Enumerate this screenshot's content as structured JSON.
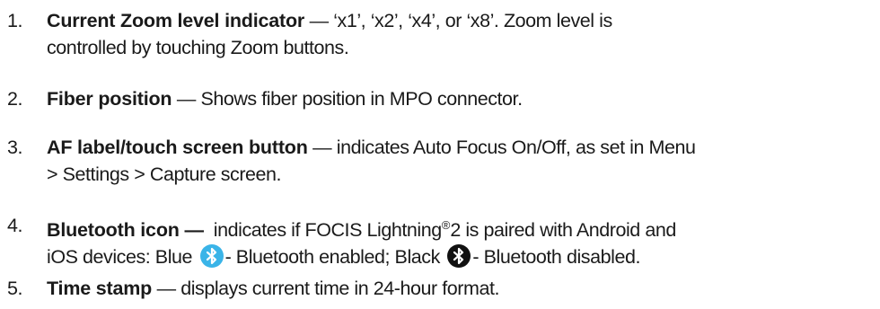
{
  "items": [
    {
      "number": "1.",
      "term": "Current Zoom level indicator",
      "separator": " — ",
      "line1_rest": "‘x1’, ‘x2’, ‘x4’, or ‘x8’. Zoom level is",
      "line2": "controlled by touching Zoom buttons."
    },
    {
      "number": "2.",
      "term": "Fiber position",
      "separator": " — ",
      "line1_rest": "Shows fiber position in MPO connector."
    },
    {
      "number": "3.",
      "term": "AF label/touch screen button",
      "separator": " — ",
      "line1_rest": "indicates Auto Focus On/Off, as set in Menu",
      "line2": "> Settings > Capture screen."
    },
    {
      "number": "4.",
      "term": "Bluetooth icon —",
      "line1_rest": "  indicates if FOCIS Lightning",
      "registered": "®",
      "line1_tail": "2 is paired with Android and",
      "line2_a": "iOS devices: Blue ",
      "line2_b": "- Bluetooth enabled; Black ",
      "line2_c": "- Bluetooth disabled.",
      "icons": {
        "enabled": "bluetooth-icon",
        "disabled": "bluetooth-icon",
        "enabled_color": "#3ab4e8",
        "disabled_color": "#111111"
      }
    },
    {
      "number": "5.",
      "term": "Time stamp",
      "separator": " — ",
      "line1_rest": "displays current time in 24-hour format."
    }
  ]
}
